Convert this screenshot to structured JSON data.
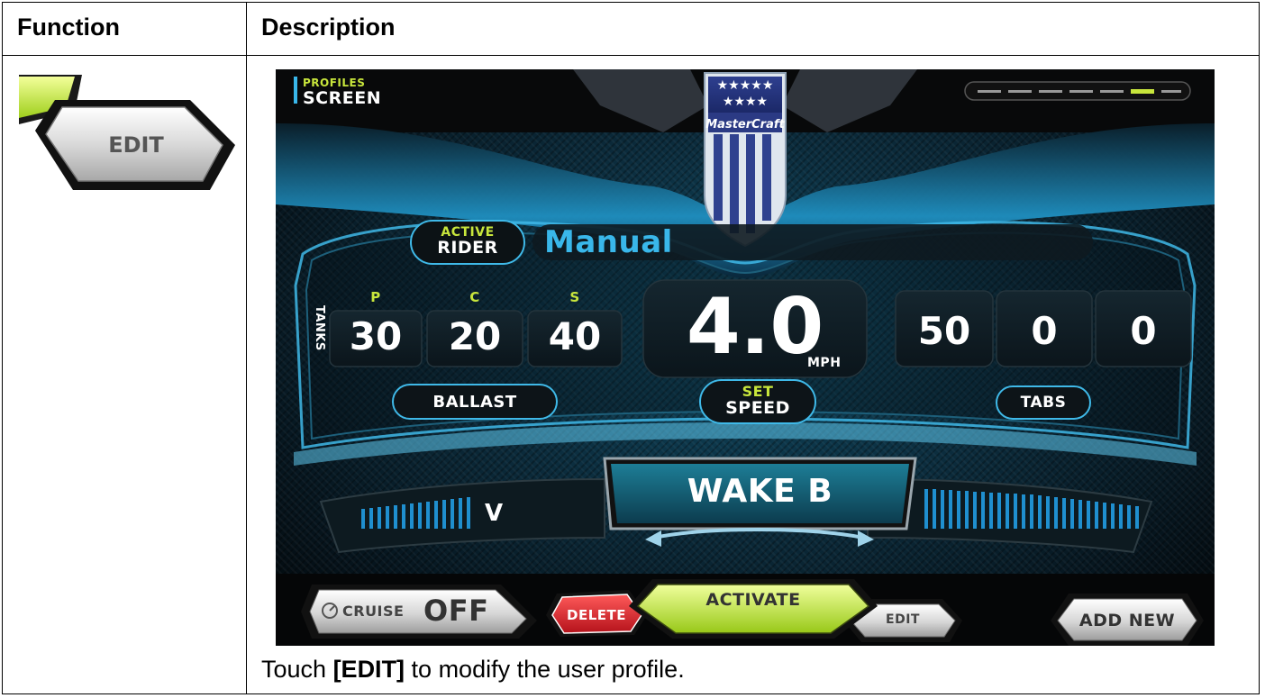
{
  "table": {
    "col_function": "Function",
    "col_description": "Description"
  },
  "function_cell": {
    "edit_label": "EDIT"
  },
  "screen": {
    "screen_small": "PROFILES",
    "screen_big": "SCREEN",
    "logo_text": "MasterCraft",
    "active_small": "ACTIVE",
    "active_big": "RIDER",
    "rider_name": "Manual",
    "tanks_label": "TANKS",
    "ballast": {
      "headers": [
        "P",
        "C",
        "S"
      ],
      "values": [
        "30",
        "20",
        "40"
      ],
      "label": "BALLAST"
    },
    "speed": {
      "value": "4.0",
      "unit": "MPH",
      "set_small": "SET",
      "set_big": "SPEED"
    },
    "tabs": {
      "values": [
        "50",
        "0",
        "0"
      ],
      "label": "TABS"
    },
    "wake": {
      "shape": "V",
      "name": "WAKE B"
    },
    "buttons": {
      "cruise_label": "CRUISE",
      "cruise_state": "OFF",
      "delete": "DELETE",
      "activate": "ACTIVATE",
      "edit": "EDIT",
      "add_new": "ADD NEW"
    },
    "colors": {
      "accent_green": "#c8e63c",
      "accent_blue": "#39b7ea",
      "delete_red": "#d5202a"
    }
  },
  "caption": {
    "pre": "Touch ",
    "bold": "[EDIT]",
    "post": " to modify the user profile."
  }
}
